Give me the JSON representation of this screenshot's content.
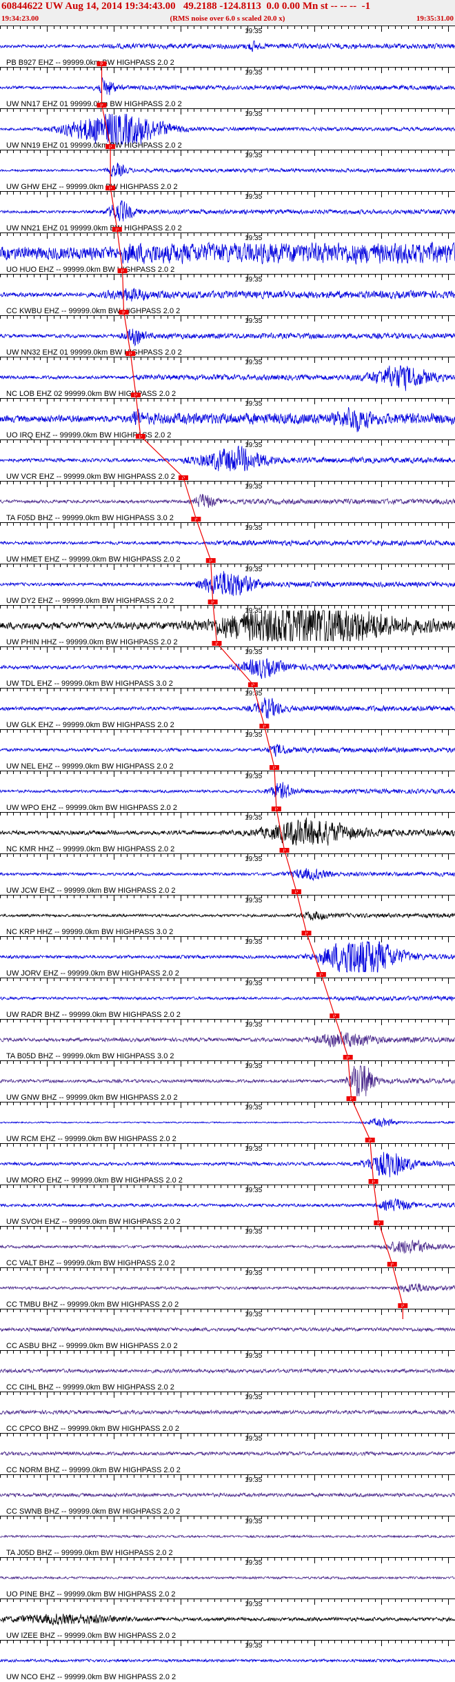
{
  "header": {
    "title": "60844622 UW Aug 14, 2014 19:34:43.00   49.2188 -124.8113  0.0 0.00 Mn st -- -- --  -1",
    "start_time": "19:34:23.00",
    "end_time": "19:35:31.00",
    "rms_note": "(RMS noise over 6.0 s scaled 20.0 x)"
  },
  "chart_data": {
    "type": "seismogram",
    "x_unit": "time (UTC)",
    "x_start": "19:34:23.00",
    "x_end": "19:35:31.00",
    "duration_s": 68,
    "tick_interval_s": 1,
    "minute_mark_label": "19:35",
    "minute_mark_offset_s": 37,
    "pick_label": "P",
    "colors": {
      "blue": "#0000dd",
      "black": "#000000",
      "purple": "#4b2a8c",
      "pick": "#ee0000",
      "tick": "#000000"
    },
    "traces": [
      {
        "label": "PB B927 EHZ -- 99999.0km BW  HIGHPASS  2.0  2",
        "pick_s": 15.2,
        "color": "blue",
        "amp": 0.14,
        "bursts": [
          [
            37.8,
            0.28,
            0.8
          ]
        ],
        "drift": 0
      },
      {
        "label": "UW NN17 EHZ 01 99999.0km BW  HIGHPASS  2.0  2",
        "pick_s": 15.2,
        "color": "blue",
        "amp": 0.12,
        "bursts": [
          [
            15.8,
            0.7,
            1.3
          ]
        ],
        "drift": 0
      },
      {
        "label": "UW NN19 EHZ 01 99999.0km BW  HIGHPASS  2.0  2",
        "pick_s": 16.5,
        "color": "blue",
        "amp": 0.1,
        "bursts": [
          [
            17.3,
            1.6,
            6.5
          ]
        ],
        "drift": 0
      },
      {
        "label": "UW GHW EHZ -- 99999.0km BW  HIGHPASS  2.0  2",
        "pick_s": 16.5,
        "color": "blue",
        "amp": 0.1,
        "bursts": [
          [
            17.5,
            0.5,
            1.3
          ]
        ],
        "drift": 0
      },
      {
        "label": "UW NN21 EHZ 01 99999.0km BW  HIGHPASS  2.0  2",
        "pick_s": 17.5,
        "color": "blue",
        "amp": 0.12,
        "bursts": [
          [
            18,
            0.8,
            1.8
          ]
        ],
        "drift": 0
      },
      {
        "label": "UO HUO EHZ -- 99999.0km BW  HIGHPASS  2.0  2",
        "pick_s": 18.3,
        "color": "blue",
        "amp": 0.55,
        "bursts": [],
        "drift": 0
      },
      {
        "label": "CC KWBU EHZ -- 99999.0km BW  HIGHPASS  2.0  2",
        "pick_s": 18.5,
        "color": "blue",
        "amp": 0.2,
        "bursts": [
          [
            19,
            0.35,
            3
          ]
        ],
        "drift": 0
      },
      {
        "label": "UW NN32 EHZ 01 99999.0km BW  HIGHPASS  2.0  2",
        "pick_s": 19.5,
        "color": "blue",
        "amp": 0.15,
        "bursts": [
          [
            20,
            0.55,
            1.5
          ]
        ],
        "drift": 0
      },
      {
        "label": "NC LOB EHZ 02 99999.0km BW  HIGHPASS  2.0  2",
        "pick_s": 20.3,
        "color": "blue",
        "amp": 0.15,
        "bursts": [
          [
            60,
            0.9,
            4
          ]
        ],
        "drift": 0
      },
      {
        "label": "UO IRQ EHZ -- 99999.0km BW  HIGHPASS  2.0  2",
        "pick_s": 21,
        "color": "blue",
        "amp": 0.3,
        "bursts": [
          [
            20.4,
            0.8,
            0.6
          ],
          [
            53,
            0.7,
            2
          ]
        ],
        "drift": 0
      },
      {
        "label": "UW VCR EHZ -- 99999.0km BW  HIGHPASS  2.0  2",
        "pick_s": 27.4,
        "color": "blue",
        "amp": 0.15,
        "bursts": [
          [
            35,
            0.9,
            4.5
          ]
        ],
        "drift": 0
      },
      {
        "label": "TA F05D BHZ -- 99999.0km BW  HIGHPASS  3.0  2",
        "pick_s": 29.3,
        "color": "purple",
        "amp": 0.14,
        "bursts": [
          [
            30.5,
            0.5,
            1.4
          ]
        ],
        "drift": 0
      },
      {
        "label": "UW HMET EHZ -- 99999.0km BW  HIGHPASS  2.0  2",
        "pick_s": 31.5,
        "color": "blue",
        "amp": 0.14,
        "bursts": [],
        "drift": 0
      },
      {
        "label": "UW DY2 EHZ -- 99999.0km BW  HIGHPASS  2.0  2",
        "pick_s": 31.8,
        "color": "blue",
        "amp": 0.14,
        "bursts": [
          [
            34,
            1.1,
            3.5
          ]
        ],
        "drift": 0
      },
      {
        "label": "UW PHIN HHZ -- 99999.0km BW  HIGHPASS  2.0  2",
        "pick_s": 32.4,
        "color": "black",
        "amp": 0.3,
        "bursts": [
          [
            46,
            1.7,
            11
          ]
        ],
        "drift": 0
      },
      {
        "label": "UW TDL EHZ -- 99999.0km BW  HIGHPASS  3.0  2",
        "pick_s": 37.8,
        "color": "blue",
        "amp": 0.16,
        "bursts": [
          [
            39,
            0.65,
            3
          ]
        ],
        "drift": 0
      },
      {
        "label": "UW GLK EHZ -- 99999.0km BW  HIGHPASS  2.0  2",
        "pick_s": 39.5,
        "color": "blue",
        "amp": 0.15,
        "bursts": [
          [
            40,
            0.7,
            2
          ]
        ],
        "drift": 0
      },
      {
        "label": "UW NEL EHZ -- 99999.0km BW  HIGHPASS  2.0  2",
        "pick_s": 41,
        "color": "blue",
        "amp": 0.14,
        "bursts": [
          [
            41.5,
            0.35,
            1.5
          ]
        ],
        "drift": 0
      },
      {
        "label": "UW WPO EHZ -- 99999.0km BW  HIGHPASS  2.0  2",
        "pick_s": 41.3,
        "color": "blue",
        "amp": 0.12,
        "bursts": [
          [
            42,
            0.6,
            1.8
          ]
        ],
        "drift": 0
      },
      {
        "label": "NC KMR HHZ -- 99999.0km BW  HIGHPASS  2.0  2",
        "pick_s": 42.5,
        "color": "black",
        "amp": 0.18,
        "bursts": [
          [
            46,
            1,
            6
          ]
        ],
        "drift": 0
      },
      {
        "label": "UW JCW EHZ -- 99999.0km BW  HIGHPASS  2.0  2",
        "pick_s": 44.3,
        "color": "blue",
        "amp": 0.12,
        "bursts": [
          [
            46,
            0.35,
            3
          ]
        ],
        "drift": 0
      },
      {
        "label": "NC KRP HHZ -- 99999.0km BW  HIGHPASS  3.0  2",
        "pick_s": 45.8,
        "color": "black",
        "amp": 0.12,
        "bursts": [
          [
            47,
            0.25,
            2
          ]
        ],
        "drift": 0
      },
      {
        "label": "UW JORV EHZ -- 99999.0km BW  HIGHPASS  2.0  2",
        "pick_s": 48,
        "color": "blue",
        "amp": 0.14,
        "bursts": [
          [
            54,
            1.8,
            5
          ]
        ],
        "drift": 0
      },
      {
        "label": "UW RADR BHZ -- 99999.0km BW  HIGHPASS  2.0  2",
        "pick_s": 50,
        "color": "blue",
        "amp": 0.12,
        "bursts": [],
        "drift": 0
      },
      {
        "label": "TA B05D BHZ -- 99999.0km BW  HIGHPASS  3.0  2",
        "pick_s": 52,
        "color": "purple",
        "amp": 0.16,
        "bursts": [
          [
            51,
            0.5,
            4
          ]
        ],
        "drift": 0
      },
      {
        "label": "UW GNW BHZ -- 99999.0km BW  HIGHPASS  2.0  2",
        "pick_s": 52.5,
        "color": "purple",
        "amp": 0.14,
        "bursts": [
          [
            54,
            1.9,
            1.6
          ]
        ],
        "drift": 0
      },
      {
        "label": "UW RCM EHZ -- 99999.0km BW  HIGHPASS  2.0  2",
        "pick_s": 55.3,
        "color": "blue",
        "amp": 0.06,
        "bursts": [
          [
            57,
            0.3,
            2
          ]
        ],
        "drift": 0
      },
      {
        "label": "UW MORO EHZ -- 99999.0km BW  HIGHPASS  2.0  2",
        "pick_s": 55.8,
        "color": "blue",
        "amp": 0.14,
        "bursts": [
          [
            58,
            1,
            3
          ]
        ],
        "drift": 0
      },
      {
        "label": "UW SVOH EHZ -- 99999.0km BW  HIGHPASS  2.0  2",
        "pick_s": 56.6,
        "color": "blue",
        "amp": 0.13,
        "bursts": [
          [
            59,
            0.4,
            2
          ]
        ],
        "drift": 0
      },
      {
        "label": "CC VALT BHZ -- 99999.0km BW  HIGHPASS  2.0  2",
        "pick_s": 58.6,
        "color": "purple",
        "amp": 0.12,
        "bursts": [
          [
            61,
            0.5,
            3
          ]
        ],
        "drift": 0
      },
      {
        "label": "CC TMBU BHZ -- 99999.0km BW  HIGHPASS  2.0  2",
        "pick_s": 60.2,
        "color": "purple",
        "amp": 0.12,
        "bursts": [
          [
            62,
            0.3,
            2
          ]
        ],
        "drift": 0
      },
      {
        "label": "CC ASBU BHZ -- 99999.0km BW  HIGHPASS  2.0  2",
        "pick_s": null,
        "color": "purple",
        "amp": 0.16,
        "bursts": [],
        "drift": 0
      },
      {
        "label": "CC CIHL BHZ -- 99999.0km BW  HIGHPASS  2.0  2",
        "pick_s": null,
        "color": "purple",
        "amp": 0.16,
        "bursts": [],
        "drift": 0
      },
      {
        "label": "CC CPCO BHZ -- 99999.0km BW  HIGHPASS  2.0  2",
        "pick_s": null,
        "color": "purple",
        "amp": 0.16,
        "bursts": [],
        "drift": 0
      },
      {
        "label": "CC NORM BHZ -- 99999.0km BW  HIGHPASS  2.0  2",
        "pick_s": null,
        "color": "purple",
        "amp": 0.16,
        "bursts": [],
        "drift": 0
      },
      {
        "label": "CC SWNB BHZ -- 99999.0km BW  HIGHPASS  2.0  2",
        "pick_s": null,
        "color": "purple",
        "amp": 0.16,
        "bursts": [],
        "drift": 0
      },
      {
        "label": "TA J05D BHZ -- 99999.0km BW  HIGHPASS  2.0  2",
        "pick_s": null,
        "color": "purple",
        "amp": 0.1,
        "bursts": [],
        "drift": 0
      },
      {
        "label": "UO PINE BHZ -- 99999.0km BW  HIGHPASS  2.0  2",
        "pick_s": null,
        "color": "purple",
        "amp": 0.1,
        "bursts": [],
        "drift": 0
      },
      {
        "label": "UW IZEE BHZ -- 99999.0km BW  HIGHPASS  2.0  2",
        "pick_s": null,
        "color": "black",
        "amp": 0.16,
        "bursts": [
          [
            10,
            0.35,
            8
          ]
        ],
        "drift": 0
      },
      {
        "label": "UW NCO EHZ -- 99999.0km BW  HIGHPASS  2.0  2",
        "pick_s": null,
        "color": "blue",
        "amp": 0.12,
        "bursts": [],
        "drift": 0
      }
    ]
  }
}
